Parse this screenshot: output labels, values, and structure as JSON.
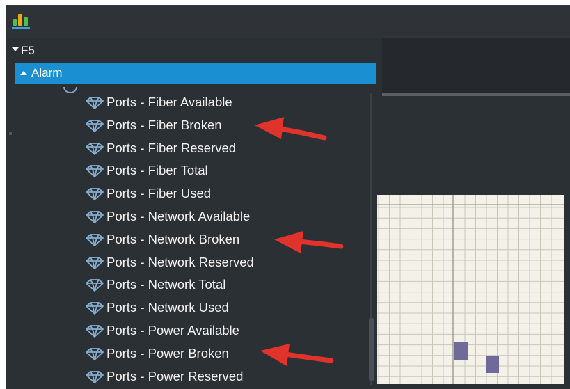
{
  "toolbar": {
    "icon": "bar-chart-icon",
    "colors": {
      "bars": [
        "#4fc24a",
        "#f2a51a",
        "#4fc24a"
      ],
      "base": "#3aa0e6"
    }
  },
  "tree": {
    "root": {
      "label": "F5",
      "expanded": true
    },
    "selected": {
      "label": "Alarm",
      "expanded": true,
      "highlight": "#1a8fd1"
    },
    "items": [
      {
        "label": "Ports - Fiber Available"
      },
      {
        "label": "Ports - Fiber Broken",
        "annotated": true
      },
      {
        "label": "Ports - Fiber Reserved"
      },
      {
        "label": "Ports - Fiber Total"
      },
      {
        "label": "Ports - Fiber Used"
      },
      {
        "label": "Ports - Network Available"
      },
      {
        "label": "Ports - Network Broken",
        "annotated": true
      },
      {
        "label": "Ports - Network Reserved"
      },
      {
        "label": "Ports - Network Total"
      },
      {
        "label": "Ports - Network Used"
      },
      {
        "label": "Ports - Power Available"
      },
      {
        "label": "Ports - Power Broken",
        "annotated": true
      },
      {
        "label": "Ports - Power Reserved"
      }
    ]
  },
  "annotation": {
    "color": "#e0332b"
  },
  "preview": {
    "background": "#f3f1e8",
    "block_color": "#6f6a9a"
  }
}
